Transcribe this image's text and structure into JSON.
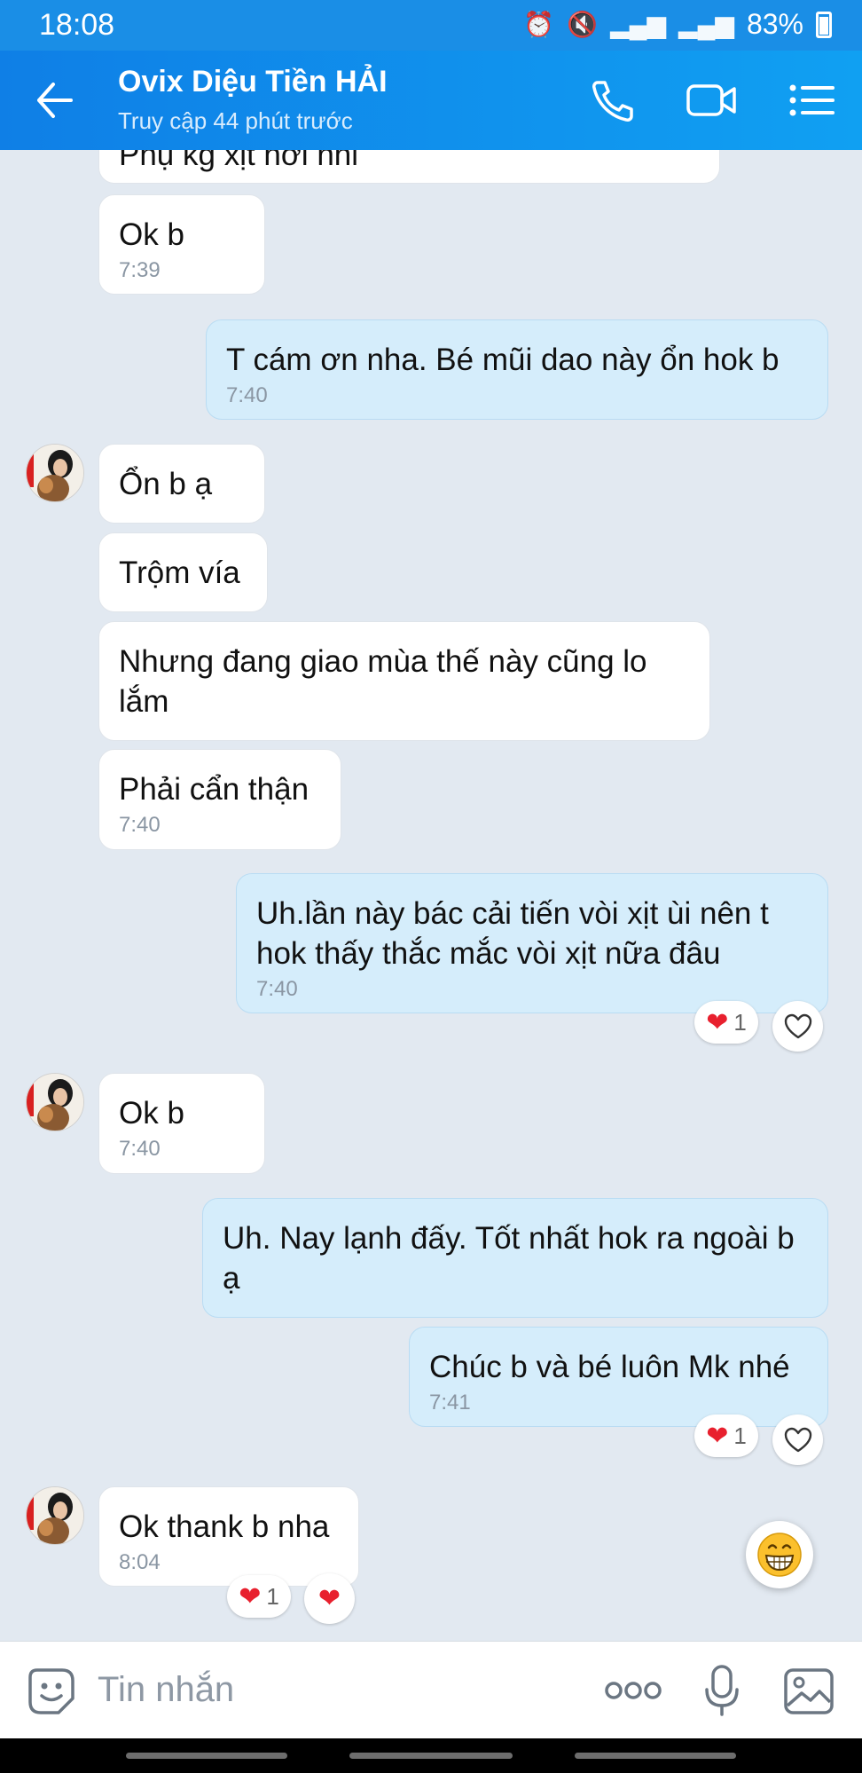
{
  "status": {
    "time": "18:08",
    "battery": "83%"
  },
  "header": {
    "title": "Ovix Diệu Tiền HẢI",
    "subtitle": "Truy cập 44 phút trước"
  },
  "messages": [
    {
      "text": "Phụ kg xịt hơi nhỉ",
      "time": ""
    },
    {
      "text": "Ok b",
      "time": "7:39"
    },
    {
      "text": "T cám ơn nha. Bé mũi dao này ổn hok b",
      "time": "7:40"
    },
    {
      "text": "Ổn b ạ",
      "time": ""
    },
    {
      "text": "Trộm vía",
      "time": ""
    },
    {
      "text": "Nhưng đang giao mùa thế này cũng lo lắm",
      "time": ""
    },
    {
      "text": "Phải cẩn thận",
      "time": "7:40"
    },
    {
      "text": "Uh.lần này bác cải tiến vòi xịt ùi nên t hok thấy thắc mắc vòi xịt nữa đâu",
      "time": "7:40"
    },
    {
      "text": "Ok b",
      "time": "7:40"
    },
    {
      "text": "Uh. Nay lạnh đấy. Tốt nhất hok ra ngoài b ạ",
      "time": ""
    },
    {
      "text": "Chúc b và bé luôn Mk nhé",
      "time": "7:41"
    },
    {
      "text": "Ok thank b nha",
      "time": "8:04"
    }
  ],
  "reactions": {
    "count1": "1",
    "count2": "1",
    "count3": "1"
  },
  "input": {
    "placeholder": "Tin nhắn"
  },
  "colors": {
    "header": "#0f7fe6",
    "chat_bg": "#e2e9f1",
    "outgoing": "#d5edfb",
    "incoming": "#ffffff",
    "heart": "#e8202e"
  }
}
